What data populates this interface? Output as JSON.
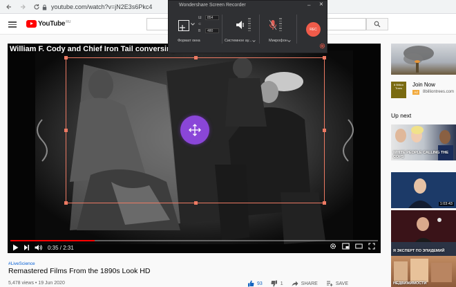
{
  "browser": {
    "url": "youtube.com/watch?v=jN2E3s6Pkc4"
  },
  "youtube": {
    "logo_text": "YouTube",
    "logo_region": "RU"
  },
  "player": {
    "overlay_title": "William F. Cody and Chief Iron Tail conversing in P",
    "time": "0:35 / 2:31",
    "progress_fraction": 0.23
  },
  "recorder": {
    "title": "Wondershare Screen Recorder",
    "width_label": "Ш",
    "width_value": "854",
    "height_label": "В",
    "height_value": "480",
    "region_label": "Формат окна",
    "system_audio_label": "Системное ау...",
    "mic_label": "Микрофон",
    "rec_label": "REC",
    "min_glyph": "–",
    "close_glyph": "×"
  },
  "video_info": {
    "hashtag": "#LiveScience",
    "title": "Remastered Films From the 1890s Look HD",
    "stats": "5,478 views • 19 Jun 2020",
    "likes": "93",
    "dislikes": "1",
    "share": "SHARE",
    "save": "SAVE"
  },
  "sidebar": {
    "ad": {
      "logo_text": "8 Billion Trees",
      "join": "Join Now",
      "badge": "Ad",
      "url": "8billiontrees.com"
    },
    "up_next": "Up next",
    "videos": [
      {
        "caption": "WHITE PEOPLE CALLING THE COPS",
        "duration": ""
      },
      {
        "caption": "",
        "duration": "1:03:43"
      },
      {
        "caption": "",
        "duration": ""
      },
      {
        "caption": "Я ЭКСПЕРТ ПО ЭПИДЕМИЙ",
        "duration": ""
      },
      {
        "caption": "НЕДВИЖИМОСТИ",
        "duration": ""
      }
    ]
  },
  "colors": {
    "recorder_bg": "#2f3033",
    "capture_border": "#ee7a63",
    "move_button": "#8a46d8",
    "rec_button": "#ef5b4a",
    "yt_red": "#ff0000"
  },
  "icons": [
    "back-icon",
    "forward-icon",
    "reload-icon",
    "lock-icon",
    "menu-icon",
    "search-icon",
    "move-icon",
    "speaker-icon",
    "microphone-icon",
    "gear-icon",
    "play-icon",
    "next-icon",
    "volume-icon",
    "settings-icon",
    "miniplayer-icon",
    "theater-icon",
    "fullscreen-icon",
    "like-icon",
    "dislike-icon",
    "share-icon",
    "save-icon"
  ]
}
